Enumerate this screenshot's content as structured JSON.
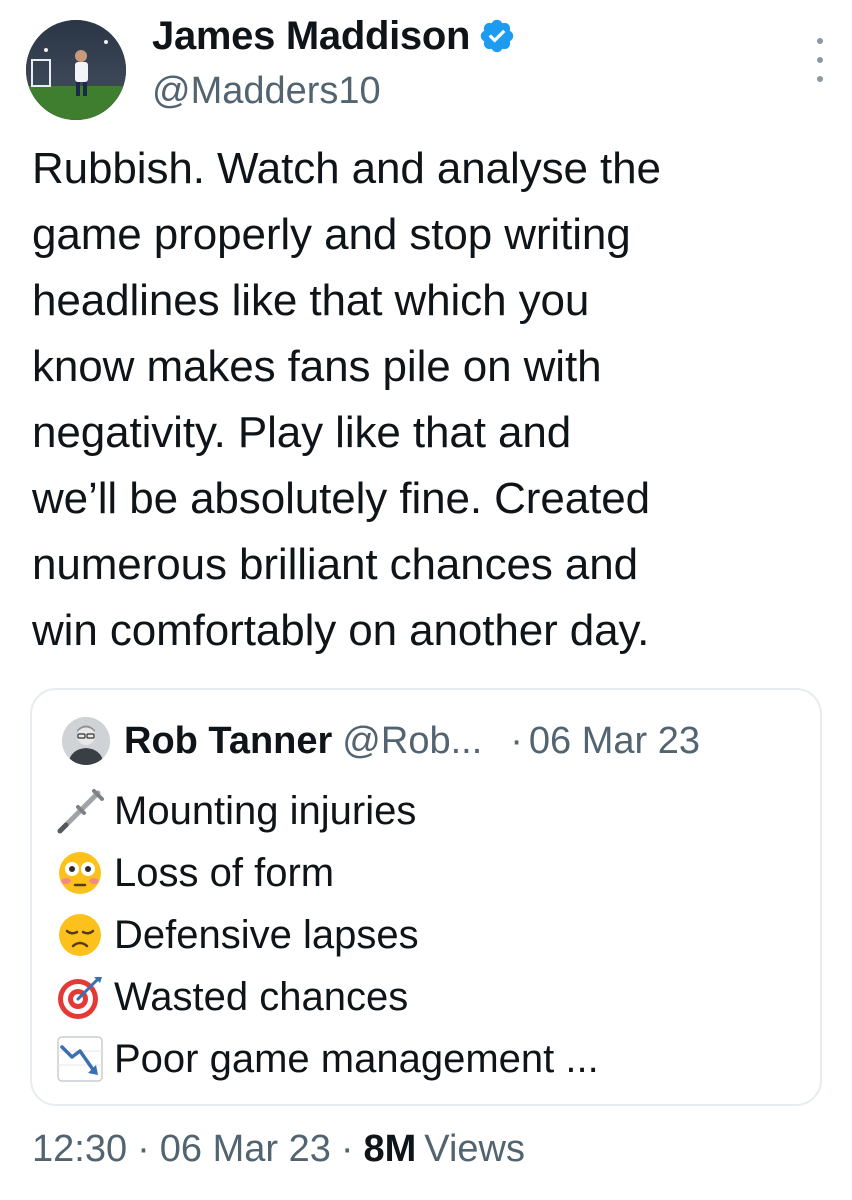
{
  "tweet": {
    "author": {
      "display_name": "James Maddison",
      "handle": "@Madders10",
      "verified": true,
      "avatar_icon": "footballer-avatar"
    },
    "text": "Rubbish. Watch and analyse the\ngame properly and stop writing\nheadlines like that which you\nknow makes fans pile on with\nnegativity. Play like that and\nwe’ll be absolutely fine. Created\nnumerous brilliant chances and\nwin comfortably on another day."
  },
  "quoted_tweet": {
    "author_name": "Rob Tanner",
    "author_handle": "@Rob...",
    "dot": "·",
    "date": "06 Mar 23",
    "lines": [
      {
        "icon": "crutch-icon",
        "text": "Mounting injuries"
      },
      {
        "icon": "flushed-face-icon",
        "text": "Loss of form"
      },
      {
        "icon": "disappointed-face-icon",
        "text": "Defensive lapses"
      },
      {
        "icon": "target-icon",
        "text": "Wasted chances"
      },
      {
        "icon": "chart-decreasing-icon",
        "text": "Poor game management ..."
      }
    ]
  },
  "footer": {
    "time": "12:30",
    "sep1": "·",
    "date": "06 Mar 23",
    "sep2": "·",
    "views_count": "8M",
    "views_label": "Views"
  },
  "colors": {
    "text": "#0f1419",
    "secondary": "#536471",
    "verified": "#1d9bf0",
    "border": "#e6ecf0"
  }
}
